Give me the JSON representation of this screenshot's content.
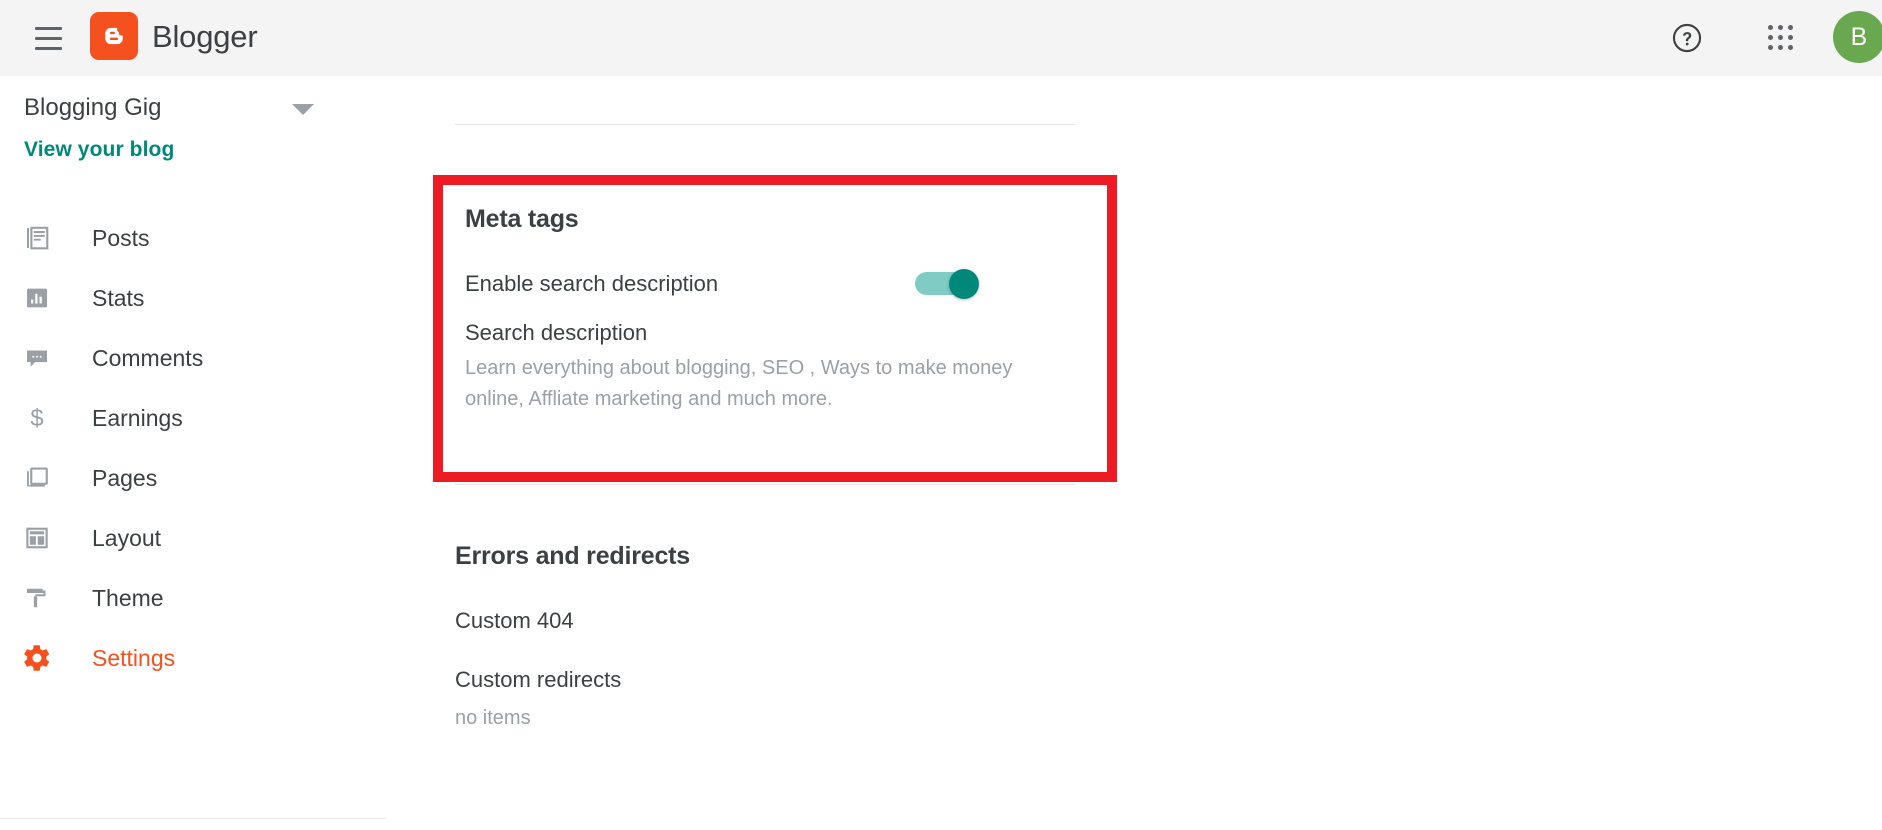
{
  "header": {
    "menu_icon": "hamburger-menu-icon",
    "logo_icon": "blogger-logo-icon",
    "brand": "Blogger",
    "help_icon": "help-circle-icon",
    "apps_icon": "apps-grid-icon",
    "avatar_initial": "B"
  },
  "sidebar": {
    "blog_name": "Blogging Gig",
    "dropdown_icon": "chevron-down-icon",
    "view_blog_link": "View your blog",
    "items": [
      {
        "label": "Posts",
        "icon": "posts-icon"
      },
      {
        "label": "Stats",
        "icon": "stats-icon"
      },
      {
        "label": "Comments",
        "icon": "comments-icon"
      },
      {
        "label": "Earnings",
        "icon": "earnings-dollar-icon"
      },
      {
        "label": "Pages",
        "icon": "pages-icon"
      },
      {
        "label": "Layout",
        "icon": "layout-icon"
      },
      {
        "label": "Theme",
        "icon": "theme-paint-roller-icon"
      },
      {
        "label": "Settings",
        "icon": "settings-gear-icon"
      }
    ],
    "active_item": "Settings"
  },
  "main": {
    "meta_tags": {
      "title": "Meta tags",
      "enable_search_description_label": "Enable search description",
      "enable_search_description_state": "on",
      "search_description_label": "Search description",
      "search_description_value": "Learn everything about blogging, SEO , Ways to make money online, Affliate marketing and much more."
    },
    "errors_and_redirects": {
      "title": "Errors and redirects",
      "custom_404_label": "Custom 404",
      "custom_redirects_label": "Custom redirects",
      "custom_redirects_value": "no items"
    }
  },
  "colors": {
    "brand_orange": "#f4511e",
    "teal_link": "#00897b",
    "toggle_track": "#80cbc4",
    "toggle_thumb": "#00897b",
    "highlight_red": "#ed1c24",
    "avatar_green": "#6aa84f",
    "appbar_bg": "#f4f4f4"
  }
}
